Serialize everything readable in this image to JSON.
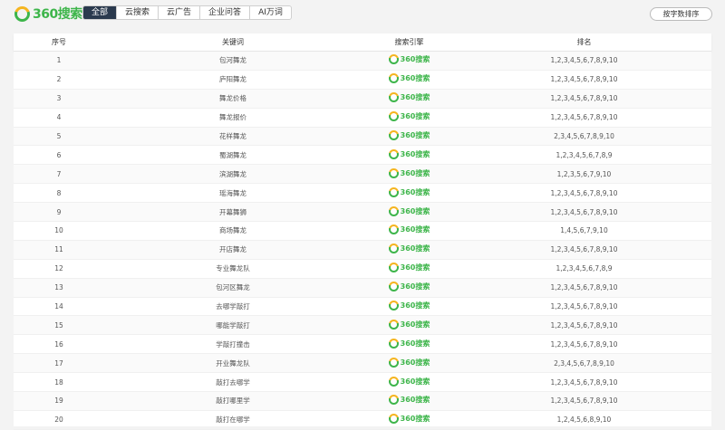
{
  "logo": {
    "text": "360搜索"
  },
  "tabs": [
    {
      "label": "全部",
      "active": true
    },
    {
      "label": "云搜索",
      "active": false
    },
    {
      "label": "云广告",
      "active": false
    },
    {
      "label": "企业问答",
      "active": false
    },
    {
      "label": "AI万词",
      "active": false
    }
  ],
  "sort_button": "按字数排序",
  "columns": [
    "序号",
    "关键词",
    "搜索引擎",
    "排名"
  ],
  "engine_label": "360搜索",
  "colors": {
    "brand_green": "#3db54a",
    "brand_yellow": "#f5b520",
    "active_tab": "#2b3a4e"
  },
  "rows": [
    {
      "no": "1",
      "keyword": "包河舞龙",
      "rank": "1,2,3,4,5,6,7,8,9,10"
    },
    {
      "no": "2",
      "keyword": "庐阳舞龙",
      "rank": "1,2,3,4,5,6,7,8,9,10"
    },
    {
      "no": "3",
      "keyword": "舞龙价格",
      "rank": "1,2,3,4,5,6,7,8,9,10"
    },
    {
      "no": "4",
      "keyword": "舞龙报价",
      "rank": "1,2,3,4,5,6,7,8,9,10"
    },
    {
      "no": "5",
      "keyword": "花样舞龙",
      "rank": "2,3,4,5,6,7,8,9,10"
    },
    {
      "no": "6",
      "keyword": "蜀湖舞龙",
      "rank": "1,2,3,4,5,6,7,8,9"
    },
    {
      "no": "7",
      "keyword": "滨湖舞龙",
      "rank": "1,2,3,5,6,7,9,10"
    },
    {
      "no": "8",
      "keyword": "瑶海舞龙",
      "rank": "1,2,3,4,5,6,7,8,9,10"
    },
    {
      "no": "9",
      "keyword": "开幕舞狮",
      "rank": "1,2,3,4,5,6,7,8,9,10"
    },
    {
      "no": "10",
      "keyword": "商场舞龙",
      "rank": "1,4,5,6,7,9,10"
    },
    {
      "no": "11",
      "keyword": "开店舞龙",
      "rank": "1,2,3,4,5,6,7,8,9,10"
    },
    {
      "no": "12",
      "keyword": "专业舞龙队",
      "rank": "1,2,3,4,5,6,7,8,9"
    },
    {
      "no": "13",
      "keyword": "包河区舞龙",
      "rank": "1,2,3,4,5,6,7,8,9,10"
    },
    {
      "no": "14",
      "keyword": "去哪学敲打",
      "rank": "1,2,3,4,5,6,7,8,9,10"
    },
    {
      "no": "15",
      "keyword": "哪能学敲打",
      "rank": "1,2,3,4,5,6,7,8,9,10"
    },
    {
      "no": "16",
      "keyword": "学敲打撞击",
      "rank": "1,2,3,4,5,6,7,8,9,10"
    },
    {
      "no": "17",
      "keyword": "开业舞龙队",
      "rank": "2,3,4,5,6,7,8,9,10"
    },
    {
      "no": "18",
      "keyword": "敲打去哪学",
      "rank": "1,2,3,4,5,6,7,8,9,10"
    },
    {
      "no": "19",
      "keyword": "敲打哪里学",
      "rank": "1,2,3,4,5,6,7,8,9,10"
    },
    {
      "no": "20",
      "keyword": "敲打在哪学",
      "rank": "1,2,4,5,6,8,9,10"
    }
  ]
}
